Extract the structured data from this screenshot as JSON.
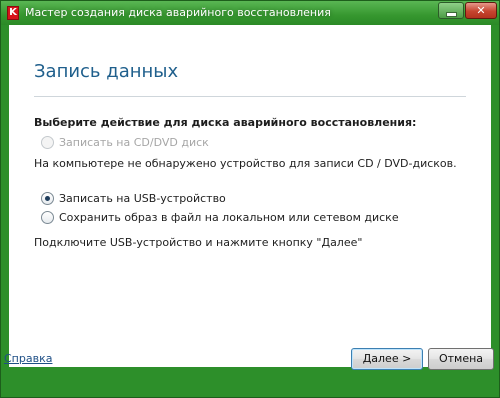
{
  "window": {
    "title": "Мастер создания диска аварийного восстановления",
    "app_icon_glyph": "K",
    "minimize_glyph": "",
    "close_glyph": "✕"
  },
  "page": {
    "heading": "Запись данных",
    "question": "Выберите действие для диска аварийного восстановления:"
  },
  "options": {
    "cd": {
      "label": "Записать на CD/DVD диск",
      "enabled": false,
      "selected": false
    },
    "cd_info": "На компьютере не обнаружено устройство для записи CD / DVD-дисков.",
    "usb": {
      "label": "Записать на USB-устройство",
      "enabled": true,
      "selected": true
    },
    "save": {
      "label": "Сохранить образ в файл на локальном или сетевом диске",
      "enabled": true,
      "selected": false
    },
    "usb_info": "Подключите USB-устройство и нажмите кнопку \"Далее\""
  },
  "footer": {
    "help_link": "Справка",
    "next_button": "Далее >",
    "cancel_button": "Отмена"
  },
  "colors": {
    "frame": "#2d8f2a",
    "heading": "#1f5f8c",
    "close_button": "#c6442f"
  }
}
